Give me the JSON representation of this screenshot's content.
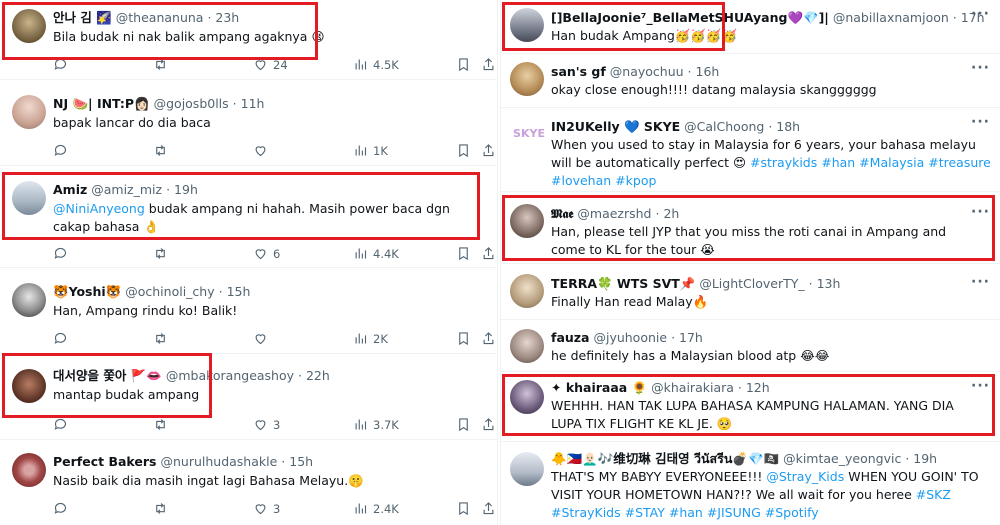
{
  "left_tweets": [
    {
      "name": "안나 김 🌠",
      "handle": "@theananuna",
      "time": "23h",
      "text": "Bila budak ni nak balik ampang agaknya 😫",
      "likes": "24",
      "views": "4.5K",
      "replies": "",
      "retweets": ""
    },
    {
      "name": "NJ 🍉| INT:P👩🏻",
      "handle": "@gojosb0lls",
      "time": "11h",
      "text": "bapak lancar do dia baca",
      "likes": "",
      "views": "1K",
      "replies": "",
      "retweets": ""
    },
    {
      "name": "Amiz",
      "handle": "@amiz_miz",
      "time": "19h",
      "mention": "@NiniAnyeong",
      "text": " budak ampang ni hahah. Masih power baca dgn cakap bahasa 👌",
      "likes": "6",
      "views": "4.4K",
      "replies": "",
      "retweets": ""
    },
    {
      "name": "🐯Yoshi🐯",
      "handle": "@ochinoli_chy",
      "time": "15h",
      "text": "Han, Ampang rindu ko! Balik!",
      "likes": "",
      "views": "2K",
      "replies": "",
      "retweets": ""
    },
    {
      "name": "대서양을 쫓아 🚩👄",
      "handle": "@mbakorangeashoy",
      "time": "22h",
      "text": "mantap budak ampang",
      "likes": "3",
      "views": "3.7K",
      "replies": "",
      "retweets": ""
    },
    {
      "name": "Perfect Bakers",
      "handle": "@nurulhudashakle",
      "time": "15h",
      "text": "Nasib baik dia masih ingat lagi Bahasa Melayu.🤫",
      "likes": "3",
      "views": "2.4K",
      "replies": "",
      "retweets": ""
    }
  ],
  "right_tweets": [
    {
      "name": "[]BellaJoonie⁷_BellaMetSHUAyang💜💎]|",
      "handle": "@nabillaxnamjoon",
      "time": "17h",
      "text": "Han budak Ampang🥳🥳🥳🥳"
    },
    {
      "name": "san's gf",
      "handle": "@nayochuu",
      "time": "16h",
      "text": "okay close enough!!!! datang malaysia skangggggg"
    },
    {
      "name": "IN2UKelly 💙 SKYE",
      "handle": "@CalChoong",
      "time": "18h",
      "text": "When you used to stay in Malaysia for 6 years, your bahasa melayu will be automatically perfect 😍 ",
      "hashtags_line1": "#straykids #han #Malaysia #treasure #lovehan",
      "hashtags_line2": "#kpop"
    },
    {
      "name": "𝕸𝖆𝖊",
      "handle": "@maezrshd",
      "time": "2h",
      "text": "Han, please tell JYP that you miss the roti canai in Ampang and come to KL for the tour 😭"
    },
    {
      "name": "TERRA🍀 WTS SVT📌",
      "handle": "@LightCloverTY_",
      "time": "13h",
      "text": "Finally Han read Malay🔥"
    },
    {
      "name": "fauza",
      "handle": "@jyuhoonie",
      "time": "17h",
      "text": "he definitely has a Malaysian blood atp 😂😂"
    },
    {
      "name": "✦ khairaaa 🌻",
      "handle": "@khairakiara",
      "time": "12h",
      "text": "WEHHH. HAN TAK LUPA BAHASA KAMPUNG HALAMAN. YANG DIA LUPA TIX FLIGHT KE KL JE. 🥺"
    },
    {
      "name": "🐥🇵🇭👨🏻‍🦲🎶维切琳 김태영 วีนัสรีน💣💎🏴‍☠️",
      "handle": "@kimtae_yeongvic",
      "time": "19h",
      "text_a": "THAT'S MY BABYY EVERYONEEE!!! ",
      "mention": "@Stray_Kids",
      "text_b": " WHEN YOU GOIN' TO VISIT YOUR HOMETOWN HAN?!? We all wait for you heree ",
      "hashtags_a": "#SKZ #StrayKids",
      "hashtags_b": "#STAY #han #JISUNG #Spotify"
    }
  ],
  "separator": "·",
  "more_glyph": "···",
  "colors": {
    "link": "#1d9bf0",
    "highlight_box": "#e31b23",
    "muted": "#536471",
    "text": "#0f1419"
  }
}
